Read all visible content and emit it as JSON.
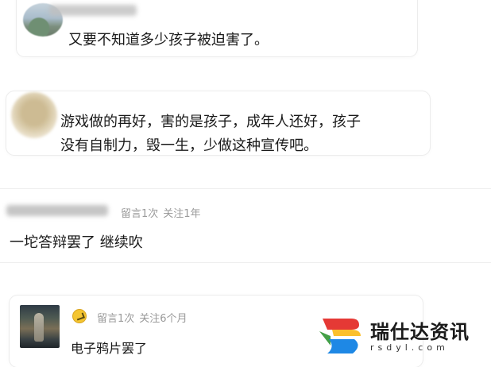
{
  "comments": [
    {
      "text": "又要不知道多少孩子被迫害了。"
    },
    {
      "lines": [
        "游戏做的再好，害的是孩子，成年人还好，孩子",
        "没有自制力，毁一生，少做这种宣传吧。"
      ]
    },
    {
      "meta_messages": "留言1次",
      "meta_follow": "关注1年",
      "text": "一坨答辩罢了 继续吹"
    },
    {
      "meta_messages": "留言1次",
      "meta_follow": "关注6个月",
      "text": "电子鸦片罢了"
    }
  ],
  "watermark": {
    "title": "瑞仕达资讯",
    "subtitle": "rsdyl.com"
  },
  "colors": {
    "meta_gray": "#9a9a9a",
    "logo_red": "#e53935",
    "logo_yellow": "#fbc02d",
    "logo_green": "#43a047",
    "logo_blue": "#1e88e5",
    "badge_yellow": "#f4c531"
  }
}
